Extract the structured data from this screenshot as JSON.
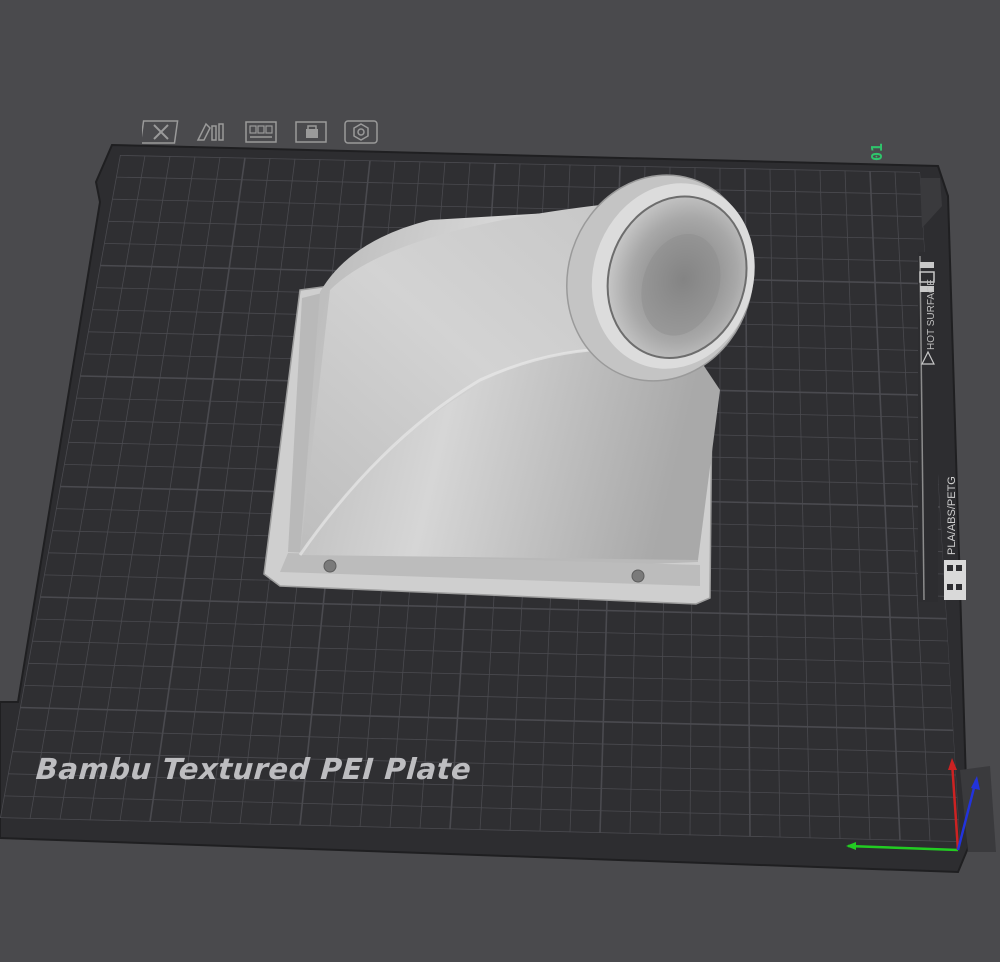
{
  "plate": {
    "label": "Bambu Textured PEI Plate",
    "number": "01",
    "warning_text": "HOT SURFACE",
    "materials_text": "PLA/ABS/PETG"
  },
  "toolbar": {
    "tools": [
      {
        "name": "remove-plate",
        "icon": "close-icon"
      },
      {
        "name": "arrange",
        "icon": "arrange-icon"
      },
      {
        "name": "layout",
        "icon": "grid-layout-icon"
      },
      {
        "name": "lock",
        "icon": "lock-icon"
      },
      {
        "name": "plate-settings",
        "icon": "gear-icon"
      }
    ]
  },
  "model": {
    "name": "duct-adapter",
    "color": "#c9c9c9"
  },
  "colors": {
    "background": "#4a4a4d",
    "plate": "#2d2d30",
    "grid": "#4c4c50",
    "label": "#bdbdc0",
    "plate_number": "#2fc46b",
    "axis_x": "#22cc22",
    "axis_y": "#cc2222",
    "axis_z": "#2233dd"
  }
}
